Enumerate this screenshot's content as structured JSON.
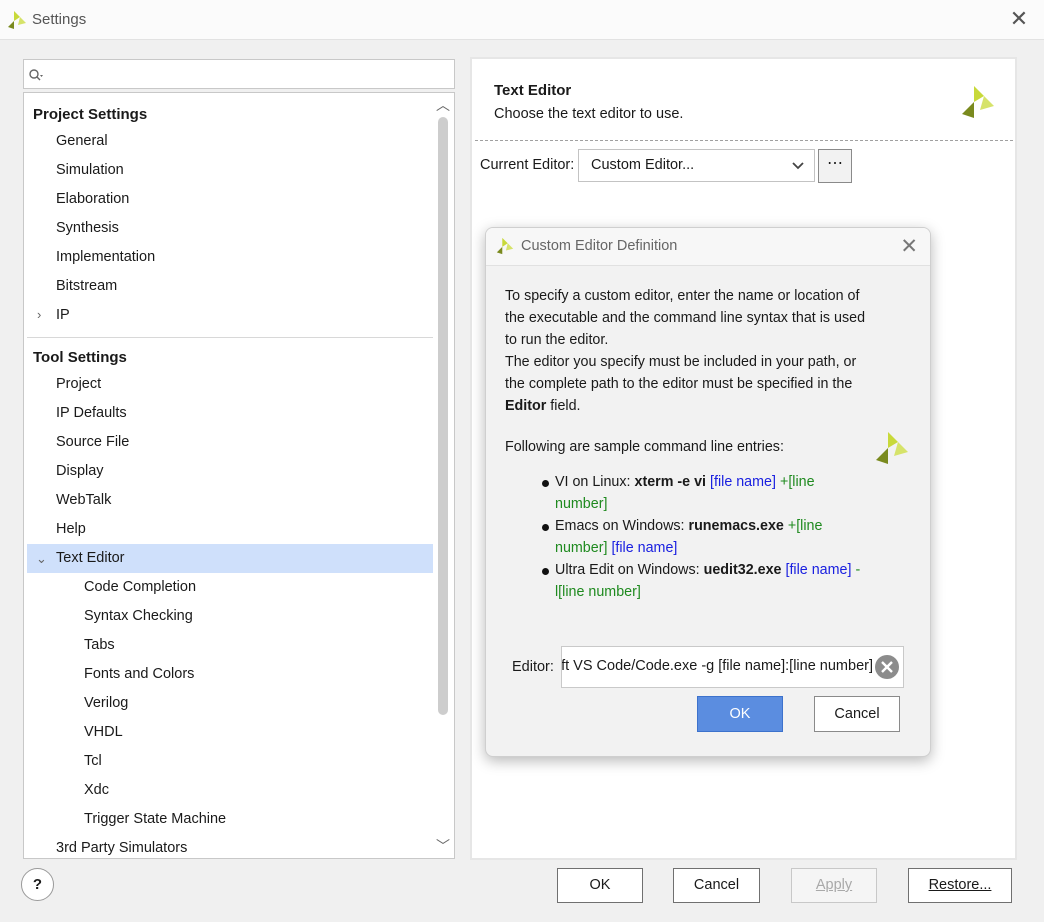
{
  "window": {
    "title": "Settings",
    "close_icon": "close-icon"
  },
  "search": {
    "placeholder": ""
  },
  "tree": {
    "project_header": "Project Settings",
    "project_items": [
      "General",
      "Simulation",
      "Elaboration",
      "Synthesis",
      "Implementation",
      "Bitstream",
      "IP"
    ],
    "tool_header": "Tool Settings",
    "tool_items": [
      "Project",
      "IP Defaults",
      "Source File",
      "Display",
      "WebTalk",
      "Help",
      "Text Editor"
    ],
    "text_editor_children": [
      "Code Completion",
      "Syntax Checking",
      "Tabs",
      "Fonts and Colors",
      "Verilog",
      "VHDL",
      "Tcl",
      "Xdc",
      "Trigger State Machine"
    ],
    "last_item": "3rd Party Simulators",
    "selected": "Text Editor"
  },
  "panel": {
    "title": "Text Editor",
    "subtitle": "Choose the text editor to use.",
    "current_editor_label": "Current Editor:",
    "current_editor_value": "Custom Editor...",
    "browse_label": "⋯"
  },
  "dialog": {
    "title": "Custom Editor Definition",
    "para1": "To specify a custom editor, enter the name or location of the executable and the command line syntax that is used to run the editor.",
    "para2_a": "The editor you specify must be included in your path, or the complete path to the editor must be specified in the",
    "para2_bold": "Editor",
    "para2_b": "field.",
    "sample_heading": "Following are sample command line entries:",
    "samples": [
      {
        "prefix": "VI on Linux:",
        "cmd": "xterm -e vi",
        "file": "[file name]",
        "line": "+[line number]"
      },
      {
        "prefix": "Emacs on Windows:",
        "cmd": "runemacs.exe",
        "line": "+[line number]",
        "file": "[file name]"
      },
      {
        "prefix": "Ultra Edit on Windows:",
        "cmd": "uedit32.exe",
        "file": "[file name]",
        "line": "-l[line number]"
      }
    ],
    "editor_label": "Editor:",
    "editor_value": "rosoft VS Code/Code.exe -g [file name]:[line number]",
    "ok": "OK",
    "cancel": "Cancel"
  },
  "footer": {
    "help": "?",
    "ok": "OK",
    "cancel": "Cancel",
    "apply": "Apply",
    "restore": "Restore..."
  },
  "colors": {
    "accent": "#5b8de0",
    "selection": "#cfe0fb",
    "logo_yellow": "#c8d93a",
    "logo_olive": "#7a8a1e"
  }
}
